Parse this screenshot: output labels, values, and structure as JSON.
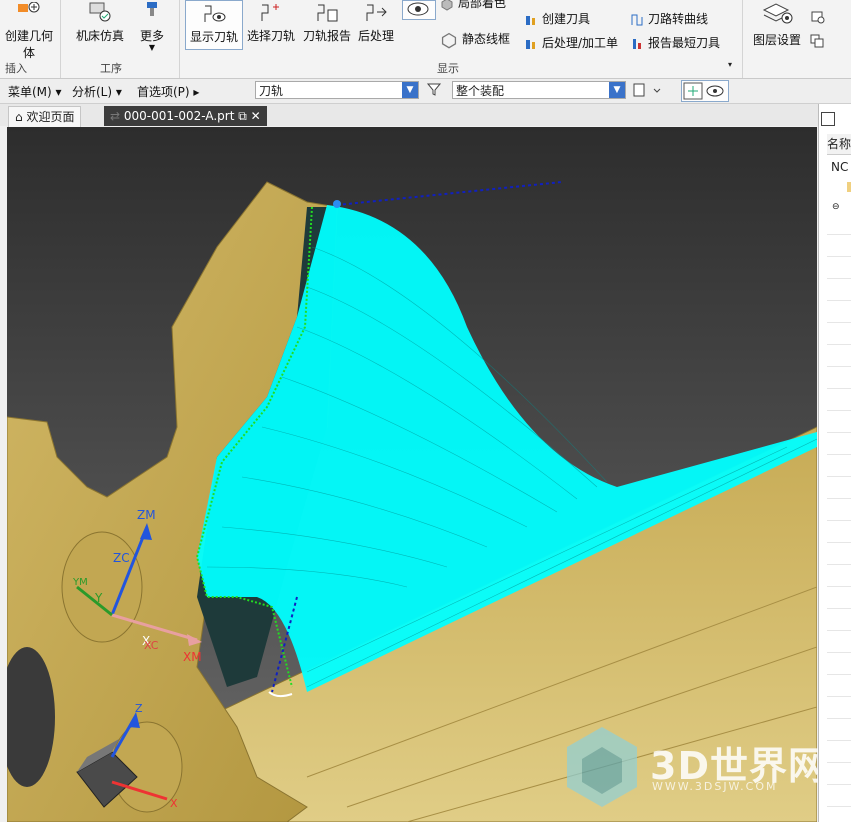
{
  "ribbon": {
    "groups": [
      {
        "label": "插入"
      },
      {
        "label": "工序"
      },
      {
        "label": "显示"
      }
    ],
    "create_geometry": "创建几何体",
    "machine_sim": "机床仿真",
    "more": "更多",
    "show_path": "显示刀轨",
    "select_path": "选择刀轨",
    "path_report": "刀轨报告",
    "post_process": "后处理",
    "local_shading": "局部着色",
    "static_wireframe": "静态线框",
    "create_tool": "创建刀具",
    "post_worksheet": "后处理/加工单",
    "path_to_curve": "刀路转曲线",
    "report_shortest_tool": "报告最短刀具",
    "layer_settings": "图层设置"
  },
  "toolbar": {
    "menu": "菜单(M)",
    "analysis": "分析(L)",
    "preferences": "首选项(P)",
    "filter_value": "刀轨",
    "assembly_value": "整个装配"
  },
  "tabs": [
    {
      "label": "欢迎页面"
    },
    {
      "label": "000-001-002-A.prt"
    }
  ],
  "right_panel": {
    "header": "名称",
    "row1": "NC"
  },
  "viewport": {
    "triad_labels": {
      "zm": "ZM",
      "zc": "ZC",
      "y": "Y",
      "ym": "YM",
      "x": "X",
      "xc": "XC",
      "xm": "XM",
      "z": "Z",
      "x2": "X"
    }
  },
  "watermark": {
    "main": "3D世界网",
    "sub": "WWW.3DSJW.COM"
  },
  "colors": {
    "part": "#c2a752",
    "toolpath": "#00ffff",
    "background_top": "#2d2d2d",
    "accent": "#3a72c9"
  }
}
